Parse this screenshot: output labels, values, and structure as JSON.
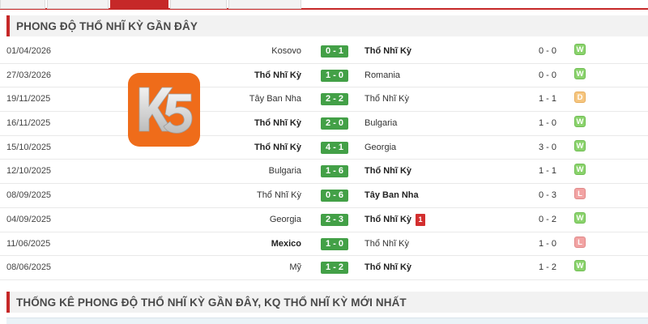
{
  "tabs": [
    {
      "label": "",
      "active": false
    },
    {
      "label": "",
      "active": false
    },
    {
      "label": "",
      "active": true
    },
    {
      "label": "",
      "active": false
    },
    {
      "label": "",
      "active": false
    }
  ],
  "section1": {
    "title": "PHONG ĐỘ THỔ NHĨ KỲ GẦN ĐÂY"
  },
  "section2": {
    "title": "THỐNG KÊ PHONG ĐỘ THỔ NHĨ KỲ GẦN ĐÂY, KQ THỔ NHĨ KỲ MỚI NHẤT"
  },
  "logo": {
    "text": "K5"
  },
  "colors": {
    "accent": "#c62828",
    "score_bg": "#43a047",
    "win": "#8bd36d",
    "draw": "#f6c680",
    "loss": "#f2a3a3"
  },
  "matches": [
    {
      "date": "01/04/2026",
      "home": "Kosovo",
      "home_bold": false,
      "score": "0 - 1",
      "away": "Thổ Nhĩ Kỳ",
      "away_bold": true,
      "ht": "0 - 0",
      "result": "W",
      "red_card": ""
    },
    {
      "date": "27/03/2026",
      "home": "Thổ Nhĩ Kỳ",
      "home_bold": true,
      "score": "1 - 0",
      "away": "Romania",
      "away_bold": false,
      "ht": "0 - 0",
      "result": "W",
      "red_card": ""
    },
    {
      "date": "19/11/2025",
      "home": "Tây Ban Nha",
      "home_bold": false,
      "score": "2 - 2",
      "away": "Thổ Nhĩ Kỳ",
      "away_bold": false,
      "ht": "1 - 1",
      "result": "D",
      "red_card": ""
    },
    {
      "date": "16/11/2025",
      "home": "Thổ Nhĩ Kỳ",
      "home_bold": true,
      "score": "2 - 0",
      "away": "Bulgaria",
      "away_bold": false,
      "ht": "1 - 0",
      "result": "W",
      "red_card": ""
    },
    {
      "date": "15/10/2025",
      "home": "Thổ Nhĩ Kỳ",
      "home_bold": true,
      "score": "4 - 1",
      "away": "Georgia",
      "away_bold": false,
      "ht": "3 - 0",
      "result": "W",
      "red_card": ""
    },
    {
      "date": "12/10/2025",
      "home": "Bulgaria",
      "home_bold": false,
      "score": "1 - 6",
      "away": "Thổ Nhĩ Kỳ",
      "away_bold": true,
      "ht": "1 - 1",
      "result": "W",
      "red_card": ""
    },
    {
      "date": "08/09/2025",
      "home": "Thổ Nhĩ Kỳ",
      "home_bold": false,
      "score": "0 - 6",
      "away": "Tây Ban Nha",
      "away_bold": true,
      "ht": "0 - 3",
      "result": "L",
      "red_card": ""
    },
    {
      "date": "04/09/2025",
      "home": "Georgia",
      "home_bold": false,
      "score": "2 - 3",
      "away": "Thổ Nhĩ Kỳ",
      "away_bold": true,
      "ht": "0 - 2",
      "result": "W",
      "red_card": "1"
    },
    {
      "date": "11/06/2025",
      "home": "Mexico",
      "home_bold": true,
      "score": "1 - 0",
      "away": "Thổ Nhĩ Kỳ",
      "away_bold": false,
      "ht": "1 - 0",
      "result": "L",
      "red_card": ""
    },
    {
      "date": "08/06/2025",
      "home": "Mỹ",
      "home_bold": false,
      "score": "1 - 2",
      "away": "Thổ Nhĩ Kỳ",
      "away_bold": true,
      "ht": "1 - 2",
      "result": "W",
      "red_card": ""
    }
  ]
}
